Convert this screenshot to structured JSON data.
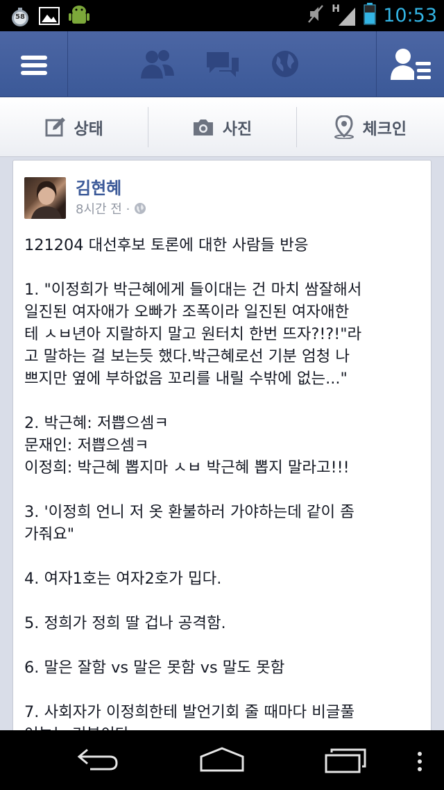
{
  "status_bar": {
    "notification_badge": "58",
    "network": "H",
    "time": "10:53",
    "icons": [
      "notification-58-icon",
      "gallery-icon",
      "android-icon",
      "mute-icon",
      "signal-icon",
      "battery-icon"
    ]
  },
  "fb_bar": {
    "icons": [
      "menu-icon",
      "friend-requests-icon",
      "messages-icon",
      "notifications-globe-icon",
      "friends-list-icon"
    ],
    "color": "#3b5998"
  },
  "actions": [
    {
      "label": "상태",
      "icon": "edit-status-icon"
    },
    {
      "label": "사진",
      "icon": "camera-icon"
    },
    {
      "label": "체크인",
      "icon": "location-pin-icon"
    }
  ],
  "post": {
    "author": "김현혜",
    "time": "8시간 전 ·",
    "lines": [
      "121204 대선후보 토론에 대한 사람들 반응",
      "",
      "1. \"이정희가 박근혜에게 들이대는 건 마치 쌈잘해서",
      "일진된 여자애가 오빠가 조폭이라 일진된 여자애한",
      "테 ㅅㅂ년아 지랄하지 말고 원터치 한번 뜨자?!?!\"라",
      "고 말하는 걸 보는듯 했다.박근혜로선 기분 엄청 나",
      "쁘지만 옆에 부하없음 꼬리를 내릴 수밖에 없는...\"",
      "",
      "2. 박근혜: 저쁩으셈ㅋ",
      "문재인: 저쁩으셈ㅋ",
      "이정희: 박근혜 뽑지마 ㅅㅂ 박근혜 뽑지 말라고!!!",
      "",
      "3. '이정희 언니 저 옷 환불하러 가야하는데 같이 좀",
      "가줘요\"",
      "",
      "4. 여자1호는 여자2호가 밉다.",
      "",
      "5. 정희가 정희 딸 겁나 공격함.",
      "",
      "6. 말은 잘함 vs 말은 못함 vs 말도 못함",
      "",
      "7. 사회자가 이정희한테 발언기회 줄 때마다 비글풀",
      "어놓는 기분이다."
    ]
  },
  "nav_bar": {
    "icons": [
      "back-icon",
      "home-icon",
      "recent-apps-icon",
      "overflow-menu-icon"
    ]
  }
}
